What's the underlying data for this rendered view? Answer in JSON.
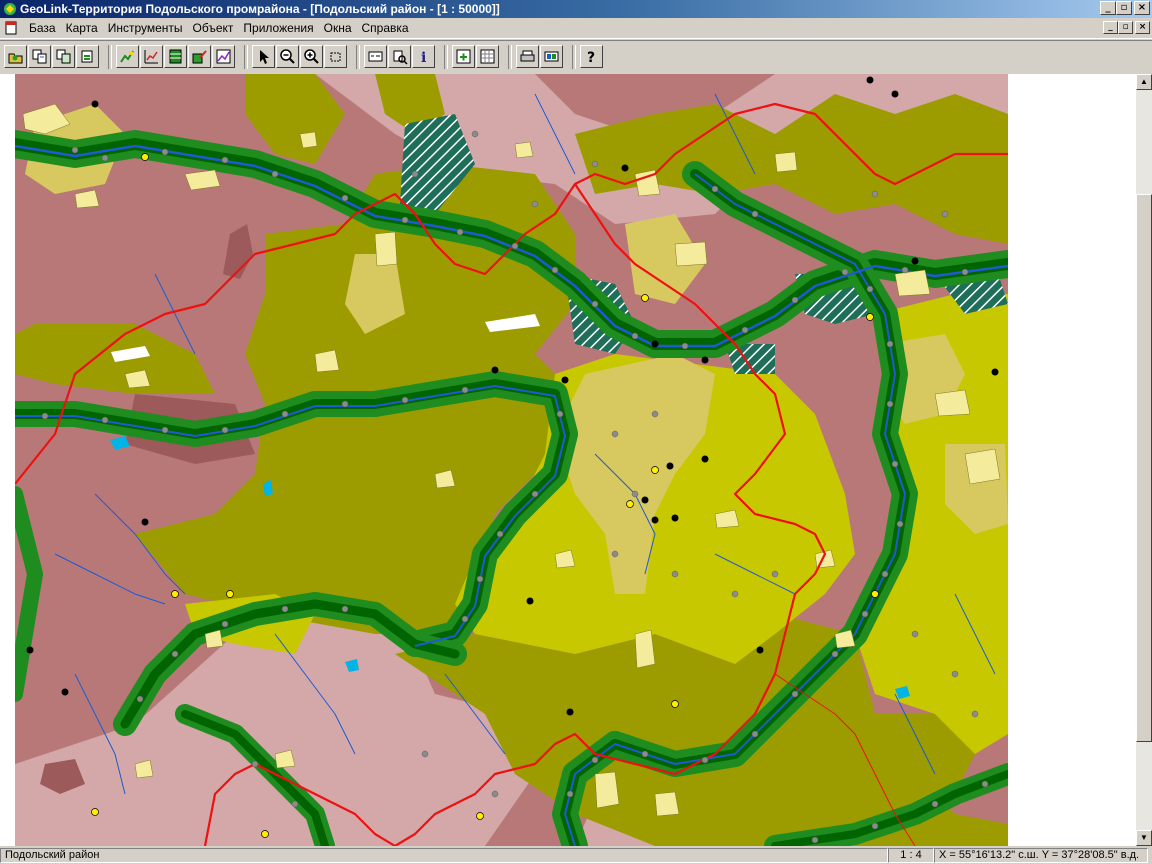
{
  "window": {
    "title": "GeoLink-Территория Подольского промрайона - [Подольский район - [1 : 50000]]",
    "minimize": "_",
    "maximize": "▫",
    "close": "×"
  },
  "menu": {
    "items": [
      {
        "label": "База"
      },
      {
        "label": "Карта"
      },
      {
        "label": "Инструменты"
      },
      {
        "label": "Объект"
      },
      {
        "label": "Приложения"
      },
      {
        "label": "Окна"
      },
      {
        "label": "Справка"
      }
    ]
  },
  "toolbar": {
    "groups": [
      [
        "open-database",
        "copy-layer",
        "paste-layer",
        "layer-properties"
      ],
      [
        "edit-object",
        "chart-edit",
        "table-view",
        "draw-object",
        "graph-view"
      ],
      [
        "select-arrow",
        "zoom-out",
        "zoom-in",
        "zoom-window"
      ],
      [
        "map-window",
        "legend-search",
        "info"
      ],
      [
        "add-window",
        "calculator"
      ],
      [
        "print",
        "export"
      ],
      [
        "help"
      ]
    ]
  },
  "status": {
    "region": "Подольский район",
    "scale": "1 : 4",
    "coords": "X = 55°16'13.2\" с.ш.  Y = 37°28'08.5\" в.д."
  },
  "colors": {
    "soil_red": "#b87878",
    "soil_pink": "#d4a8a8",
    "soil_dark": "#9c5a5a",
    "olive": "#9c9c00",
    "olive_light": "#c8c800",
    "khaki": "#d8c860",
    "forest": "#1e8c1e",
    "forest_dark": "#006400",
    "water": "#1e5ad2",
    "boundary": "#ee1111",
    "settlement": "#f4ec9c"
  }
}
